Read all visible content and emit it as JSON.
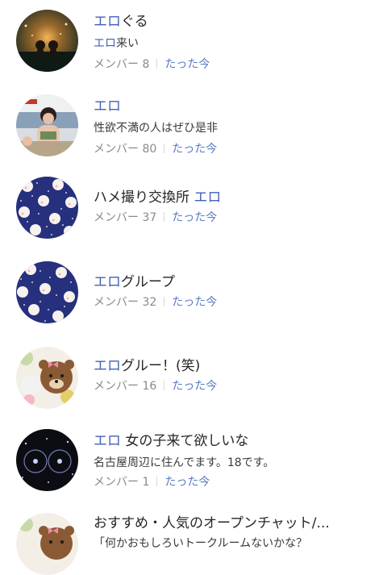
{
  "rooms": [
    {
      "avatar_icon": "night-lantern-couple-icon",
      "title_hl": "エロ",
      "title_rest": "ぐる",
      "desc_hl": "エロ",
      "desc_rest": "来い",
      "members": "メンバー 8",
      "time": "たった今"
    },
    {
      "avatar_icon": "woman-photo-icon",
      "title_hl": "エロ",
      "title_rest": "",
      "desc_hl": "",
      "desc_rest": "性欲不満の人はぜひ是非",
      "members": "メンバー 80",
      "time": "たった今"
    },
    {
      "avatar_icon": "bunny-pattern-icon",
      "title_pre": "ハメ撮り交換所 ",
      "title_hl": "エロ",
      "title_rest": "",
      "members": "メンバー 37",
      "time": "たった今"
    },
    {
      "avatar_icon": "bunny-pattern-icon",
      "title_hl": "エロ",
      "title_rest": "グループ",
      "members": "メンバー 32",
      "time": "たった今"
    },
    {
      "avatar_icon": "brown-bear-flowers-icon",
      "title_hl": "エロ",
      "title_rest": "グルー！(笑)",
      "members": "メンバー 16",
      "time": "たった今"
    },
    {
      "avatar_icon": "dark-sparkle-icon",
      "title_hl": "エロ",
      "title_rest": " 女の子来て欲しいな",
      "desc_hl": "",
      "desc_rest": "名古屋周辺に住んでます。18です。",
      "members": "メンバー 1",
      "time": "たった今"
    },
    {
      "avatar_icon": "brown-bear-flowers-icon",
      "title_hl": "",
      "title_rest": "おすすめ・人気のオープンチャット/...",
      "desc_hl": "",
      "desc_rest": "「何かおもしろいトークルームないかな？",
      "members": "",
      "time": ""
    }
  ],
  "colors": {
    "highlight": "#4360b8",
    "time": "#5a7bc2",
    "meta": "#8a8a8a"
  }
}
